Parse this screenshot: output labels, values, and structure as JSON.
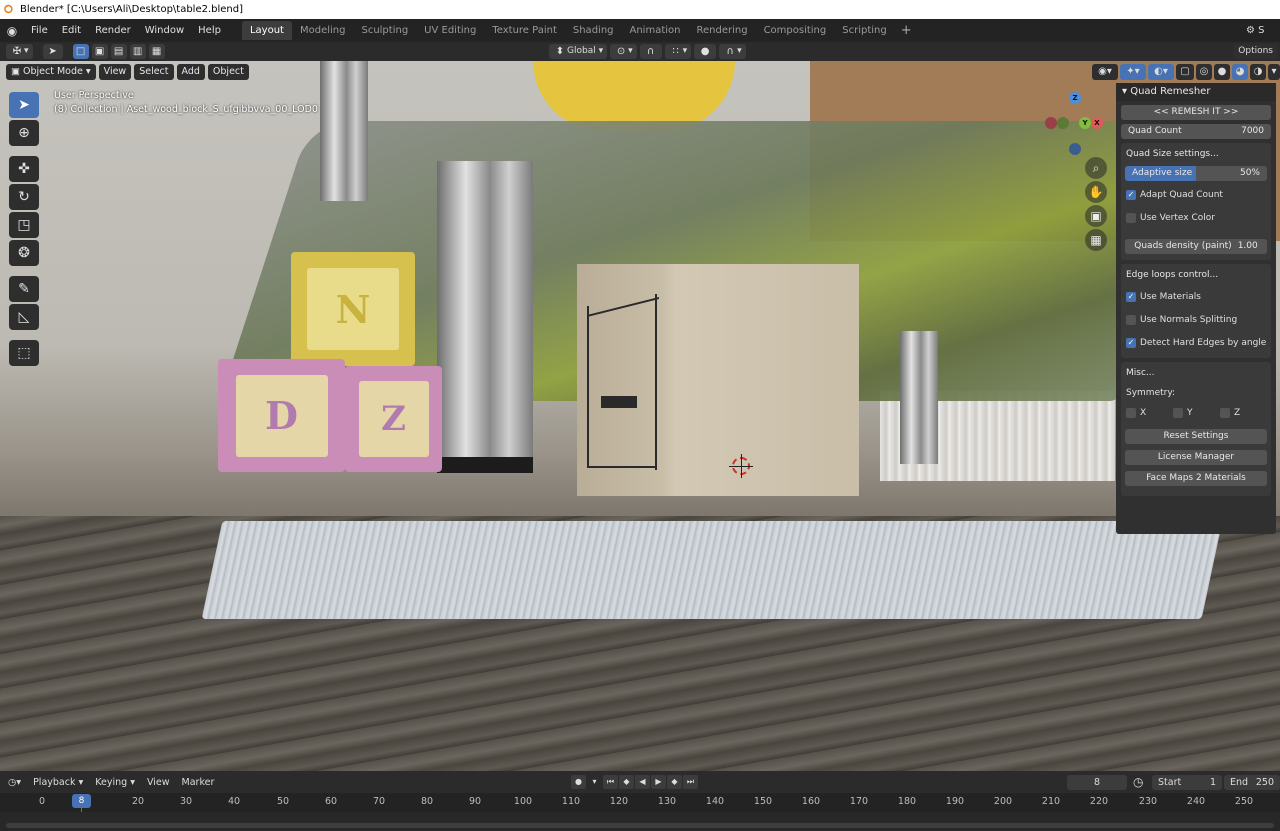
{
  "window": {
    "title": "Blender* [C:\\Users\\Ali\\Desktop\\table2.blend]"
  },
  "topbar": {
    "menus": [
      "File",
      "Edit",
      "Render",
      "Window",
      "Help"
    ],
    "workspaces": [
      "Layout",
      "Modeling",
      "Sculpting",
      "UV Editing",
      "Texture Paint",
      "Shading",
      "Animation",
      "Rendering",
      "Compositing",
      "Scripting"
    ],
    "active_workspace": "Layout",
    "add_workspace": "+",
    "scene_label": "S"
  },
  "toolheader": {
    "orientation": "Global",
    "options_label": "Options"
  },
  "viewport": {
    "mode": "Object Mode",
    "menus": [
      "View",
      "Select",
      "Add",
      "Object"
    ],
    "view_name": "User Perspective",
    "collection_info": "(8) Collection | Aset_wood_block_S_ufgibbvva_00_LOD0",
    "gizmo": {
      "x": "X",
      "y": "Y",
      "z": "Z"
    },
    "block_letters": [
      "N",
      "D",
      "Z"
    ]
  },
  "quad_remesher": {
    "title": "Quad Remesher",
    "remesh_button": "<< REMESH IT >>",
    "quad_count_label": "Quad Count",
    "quad_count_value": "7000",
    "quad_size_title": "Quad Size settings...",
    "adaptive_size_label": "Adaptive size",
    "adaptive_size_value": "50%",
    "adaptive_size_fraction": 0.5,
    "adapt_quad_count": "Adapt Quad Count",
    "adapt_quad_count_checked": true,
    "use_vertex_color": "Use Vertex Color",
    "use_vertex_color_checked": false,
    "quads_density_label": "Quads density (paint)",
    "quads_density_value": "1.00",
    "edge_loops_title": "Edge loops control...",
    "use_materials": "Use Materials",
    "use_materials_checked": true,
    "use_normals_splitting": "Use Normals Splitting",
    "use_normals_splitting_checked": false,
    "detect_hard_edges": "Detect Hard Edges by angle",
    "detect_hard_edges_checked": true,
    "misc_title": "Misc...",
    "symmetry_label": "Symmetry:",
    "sym_x": "X",
    "sym_y": "Y",
    "sym_z": "Z",
    "reset_settings": "Reset Settings",
    "license_manager": "License Manager",
    "face_maps": "Face Maps 2 Materials"
  },
  "timeline": {
    "menus": [
      "Playback",
      "Keying",
      "View",
      "Marker"
    ],
    "current_frame": "8",
    "start_label": "Start",
    "start_value": "1",
    "end_label": "End",
    "end_value": "250",
    "ruler": [
      "0",
      "20",
      "30",
      "40",
      "50",
      "60",
      "70",
      "80",
      "90",
      "100",
      "110",
      "120",
      "130",
      "140",
      "150",
      "160",
      "170",
      "180",
      "190",
      "200",
      "210",
      "220",
      "230",
      "240",
      "250"
    ],
    "playhead": "8"
  }
}
